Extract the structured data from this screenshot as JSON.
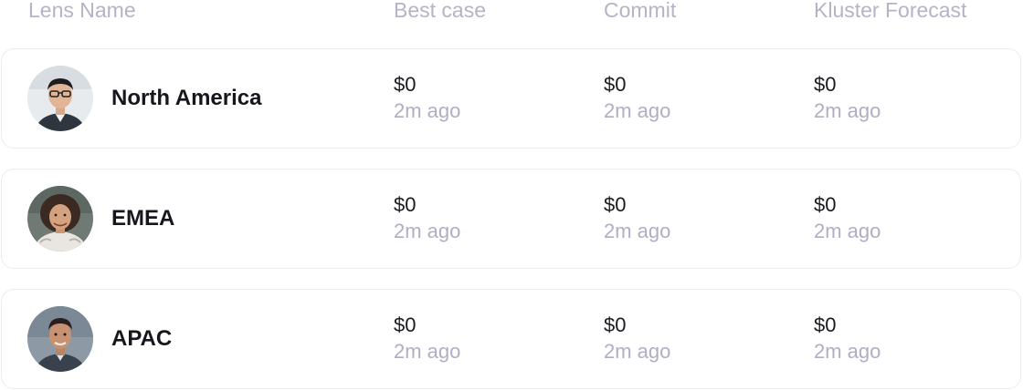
{
  "header": {
    "lens_name": "Lens Name",
    "best_case": "Best case",
    "commit": "Commit",
    "kluster_forecast": "Kluster Forecast"
  },
  "rows": [
    {
      "name": "North America",
      "avatar_icon": "person-avatar",
      "best_case": {
        "amount": "$0",
        "time": "2m ago"
      },
      "commit": {
        "amount": "$0",
        "time": "2m ago"
      },
      "kluster_forecast": {
        "amount": "$0",
        "time": "2m ago"
      }
    },
    {
      "name": "EMEA",
      "avatar_icon": "person-avatar",
      "best_case": {
        "amount": "$0",
        "time": "2m ago"
      },
      "commit": {
        "amount": "$0",
        "time": "2m ago"
      },
      "kluster_forecast": {
        "amount": "$0",
        "time": "2m ago"
      }
    },
    {
      "name": "APAC",
      "avatar_icon": "person-avatar",
      "best_case": {
        "amount": "$0",
        "time": "2m ago"
      },
      "commit": {
        "amount": "$0",
        "time": "2m ago"
      },
      "kluster_forecast": {
        "amount": "$0",
        "time": "2m ago"
      }
    }
  ],
  "colors": {
    "header_text": "#b6b3c6",
    "primary_text": "#16161c",
    "muted_text": "#b0aec2",
    "row_border": "#ececf0"
  }
}
